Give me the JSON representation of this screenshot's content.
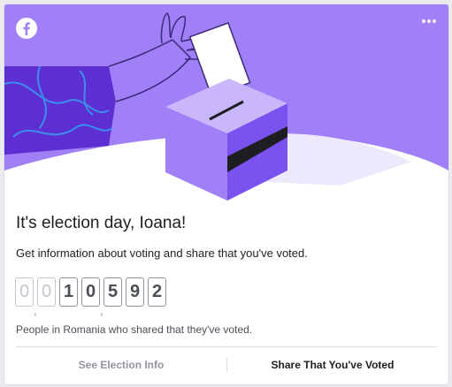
{
  "colors": {
    "banner_purple": "#a07ff7",
    "accent_purple": "#7b52f0",
    "pale_purple": "#ede8fc",
    "text_primary": "#1c1e21",
    "text_muted": "#90949c"
  },
  "header": {
    "logo_icon": "facebook-logo-icon",
    "menu_icon": "more-dots-icon"
  },
  "card": {
    "title": "It's election day, Ioana!",
    "subtitle": "Get information about voting and share that you've voted.",
    "counter": {
      "digits": [
        "0",
        "0",
        "1",
        "0",
        "5",
        "9",
        "2"
      ],
      "separator": ","
    },
    "caption": "People in Romania who shared that they've voted."
  },
  "actions": {
    "see_info_label": "See Election Info",
    "share_label": "Share That You've Voted"
  }
}
